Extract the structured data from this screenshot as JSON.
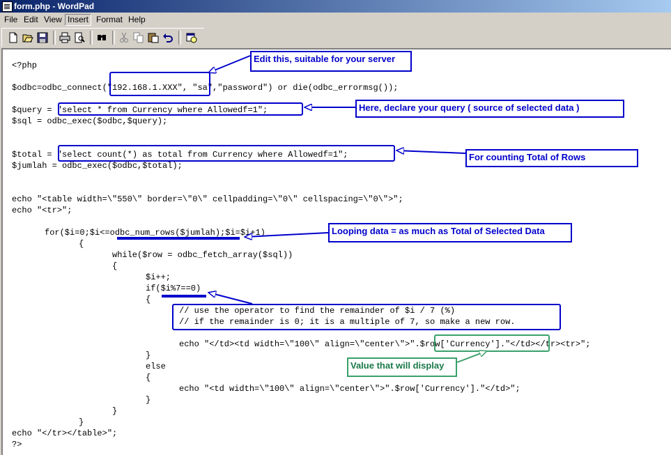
{
  "window": {
    "title": "form.php - WordPad"
  },
  "menu": [
    "File",
    "Edit",
    "View",
    "Insert",
    "Format",
    "Help"
  ],
  "toolbar": [
    "new-icon",
    "open-icon",
    "save-icon",
    "print-icon",
    "print-preview-icon",
    "find-icon",
    "cut-icon",
    "copy-icon",
    "paste-icon",
    "undo-icon",
    "insert-datetime-icon"
  ],
  "code": {
    "l1": "<?php",
    "l2": "$odbc=odbc_connect(\"192.168.1.XXX\", \"sa\",\"password\") or die(odbc_errormsg());",
    "l3": "$query = \"select * from Currency where Allowedf=1\";",
    "l4": "$sql = odbc_exec($odbc,$query);",
    "l5": "$total = \"select count(*) as total from Currency where Allowedf=1\";",
    "l6": "$jumlah = odbc_exec($odbc,$total);",
    "l7": "echo \"<table width=\\\"550\\\" border=\\\"0\\\" cellpadding=\\\"0\\\" cellspacing=\\\"0\\\">\";",
    "l8": "echo \"<tr>\";",
    "l9": "for($i=0;$i<=odbc_num_rows($jumlah);$i=$i+1)",
    "l10": "{",
    "l11": "while($row = odbc_fetch_array($sql))",
    "l12": "{",
    "l13": "$i++;",
    "l14": "if($i%7==0)",
    "l15": "{",
    "l16": "// use the operator to find the remainder of $i / 7 (%)",
    "l17": "// if the remainder is 0; it is a multiple of 7, so make a new row.",
    "l18": "echo \"</td><td width=\\\"100\\\" align=\\\"center\\\">\".$row['Currency'].\"</td></tr><tr>\";",
    "l19": "}",
    "l20": "else",
    "l21": "{",
    "l22": "echo \"<td width=\\\"100\\\" align=\\\"center\\\">\".$row['Currency'].\"</td>\";",
    "l23": "}",
    "l24": "}",
    "l25": "}",
    "l26": "echo \"</tr></table>\";",
    "l27": "?>"
  },
  "callouts": {
    "server": "Edit this, suitable for your server",
    "query": "Here, declare your query ( source of selected data )",
    "count": "For counting Total of Rows",
    "loop": "Looping data = as much as Total of Selected Data",
    "value": "Value that will display"
  },
  "colors": {
    "annotation": "#0000cc",
    "annotation_green": "#3aa06a",
    "titlebar": "#0a246a"
  }
}
